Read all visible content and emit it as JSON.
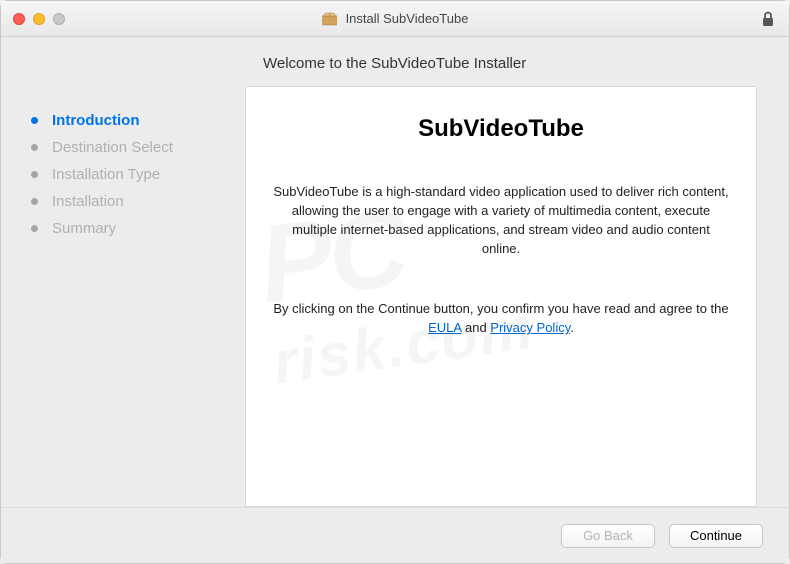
{
  "window": {
    "title": "Install SubVideoTube"
  },
  "sidebar": {
    "steps": [
      {
        "label": "Introduction",
        "active": true
      },
      {
        "label": "Destination Select",
        "active": false
      },
      {
        "label": "Installation Type",
        "active": false
      },
      {
        "label": "Installation",
        "active": false
      },
      {
        "label": "Summary",
        "active": false
      }
    ]
  },
  "main": {
    "heading": "Welcome to the SubVideoTube Installer",
    "product_name": "SubVideoTube",
    "description": "SubVideoTube is a high-standard video application used to deliver rich content, allowing the user to engage with a variety of multimedia content, execute multiple internet-based applications, and stream video and audio content online.",
    "agree_pre": "By clicking on the Continue button, you confirm you have read and agree to the ",
    "eula_label": "EULA",
    "agree_mid": " and ",
    "privacy_label": "Privacy Policy",
    "agree_post": "."
  },
  "footer": {
    "back_label": "Go Back",
    "continue_label": "Continue"
  },
  "watermark": {
    "big": "PC",
    "sub": "risk.com"
  }
}
